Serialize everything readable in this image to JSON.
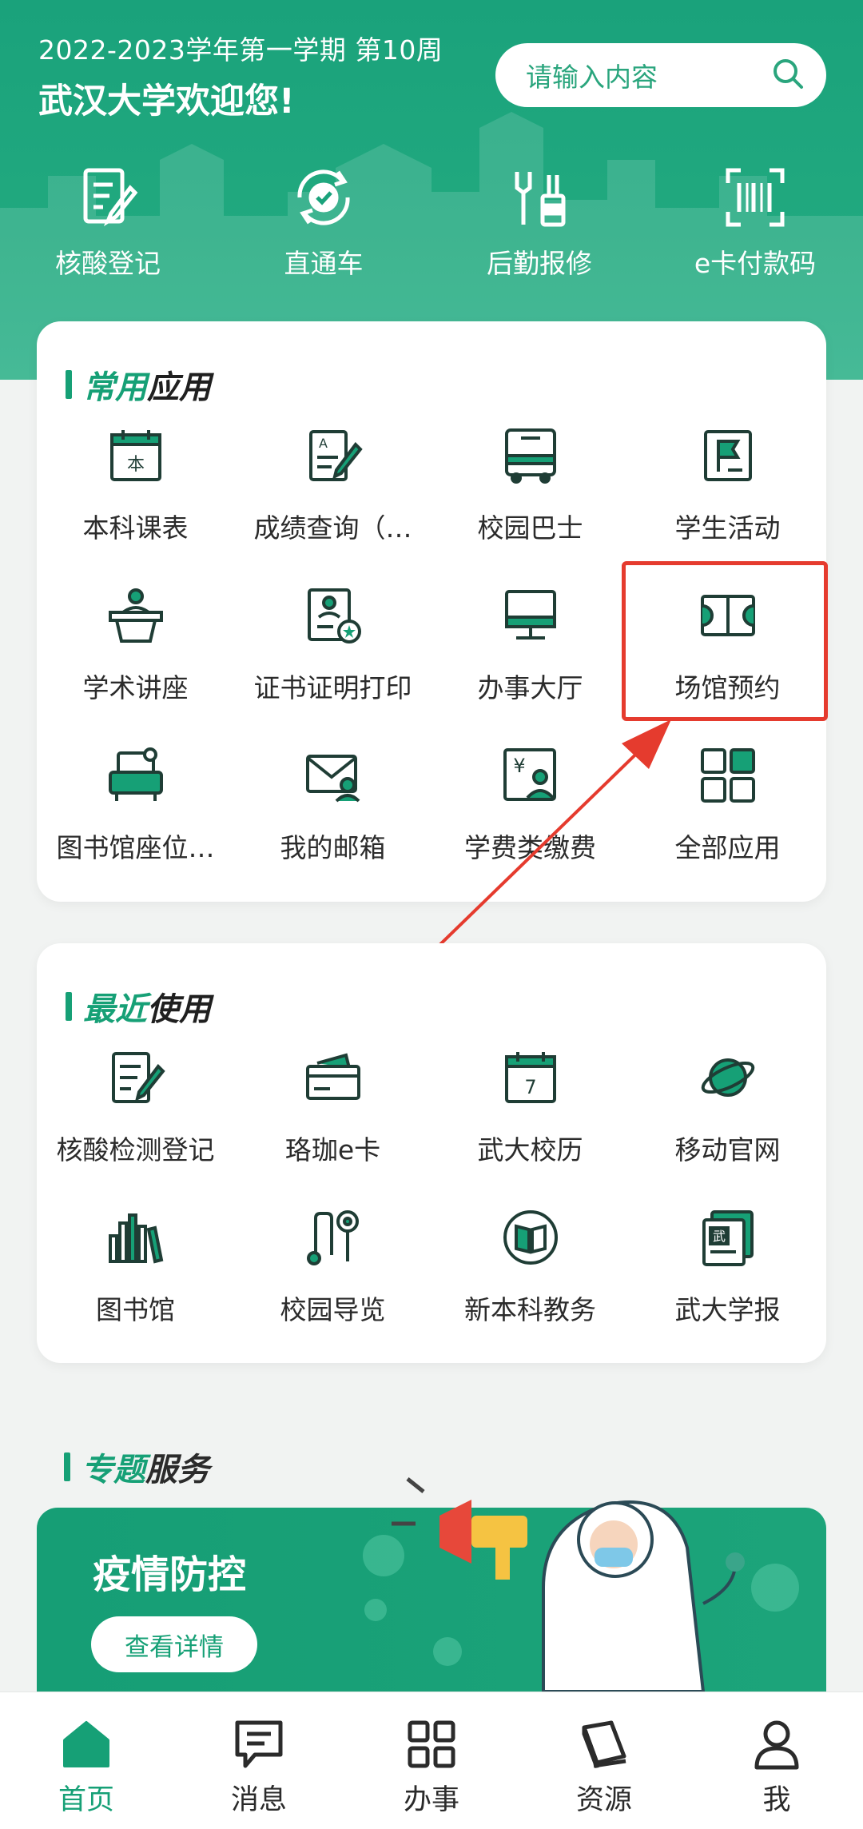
{
  "header": {
    "semester": "2022-2023学年第一学期 第10周",
    "welcome": "武汉大学欢迎您!",
    "search_placeholder": "请输入内容"
  },
  "quick_actions": [
    {
      "label": "核酸登记",
      "icon": "form-edit-icon"
    },
    {
      "label": "直通车",
      "icon": "refresh-check-icon"
    },
    {
      "label": "后勤报修",
      "icon": "tools-icon"
    },
    {
      "label": "e卡付款码",
      "icon": "barcode-scan-icon"
    }
  ],
  "common_apps": {
    "title_highlight": "常用",
    "title_rest": "应用",
    "items": [
      {
        "label": "本科课表",
        "icon": "calendar-icon"
      },
      {
        "label": "成绩查询（…",
        "icon": "score-sheet-icon"
      },
      {
        "label": "校园巴士",
        "icon": "bus-icon"
      },
      {
        "label": "学生活动",
        "icon": "flag-icon"
      },
      {
        "label": "学术讲座",
        "icon": "podium-icon"
      },
      {
        "label": "证书证明打印",
        "icon": "certificate-icon"
      },
      {
        "label": "办事大厅",
        "icon": "monitor-icon"
      },
      {
        "label": "场馆预约",
        "icon": "court-icon"
      },
      {
        "label": "图书馆座位…",
        "icon": "seat-icon"
      },
      {
        "label": "我的邮箱",
        "icon": "mail-icon"
      },
      {
        "label": "学费类缴费",
        "icon": "payment-icon"
      },
      {
        "label": "全部应用",
        "icon": "grid-icon"
      }
    ]
  },
  "recent_apps": {
    "title_highlight": "最近",
    "title_rest": "使用",
    "items": [
      {
        "label": "核酸检测登记",
        "icon": "form-edit-icon"
      },
      {
        "label": "珞珈e卡",
        "icon": "card-icon"
      },
      {
        "label": "武大校历",
        "icon": "calendar-7-icon"
      },
      {
        "label": "移动官网",
        "icon": "planet-icon"
      },
      {
        "label": "图书馆",
        "icon": "books-icon"
      },
      {
        "label": "校园导览",
        "icon": "map-pin-icon"
      },
      {
        "label": "新本科教务",
        "icon": "book-circle-icon"
      },
      {
        "label": "武大学报",
        "icon": "newspaper-icon"
      }
    ]
  },
  "topic": {
    "title_highlight": "专题",
    "title_rest": "服务",
    "banner_title": "疫情防控",
    "banner_button": "查看详情"
  },
  "tabs": [
    {
      "label": "首页",
      "icon": "home-icon",
      "active": true
    },
    {
      "label": "消息",
      "icon": "message-icon",
      "active": false
    },
    {
      "label": "办事",
      "icon": "apps-grid-icon",
      "active": false
    },
    {
      "label": "资源",
      "icon": "book-stack-icon",
      "active": false
    },
    {
      "label": "我",
      "icon": "user-icon",
      "active": false
    }
  ],
  "colors": {
    "brand": "#16a076",
    "highlight": "#e53b2e"
  }
}
